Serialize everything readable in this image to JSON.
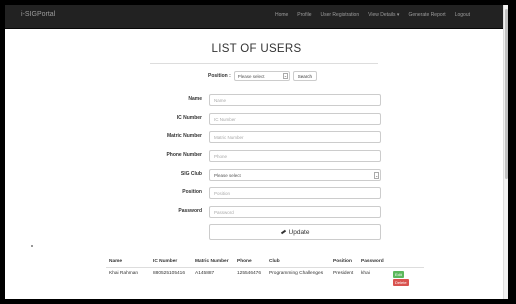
{
  "navbar": {
    "brand": "i-SIGPortal",
    "links": [
      "Home",
      "Profile",
      "User Registration",
      "View Details ▾",
      "Generate Report",
      "Logout"
    ]
  },
  "page_title": "LIST OF USERS",
  "filter": {
    "label": "Position :",
    "select_value": "Please select",
    "search_button": "Search"
  },
  "form": {
    "name": {
      "label": "Name",
      "placeholder": "Name"
    },
    "ic_number": {
      "label": "IC Number",
      "placeholder": "IC Number"
    },
    "matric_number": {
      "label": "Matric Number",
      "placeholder": "Matric Number"
    },
    "phone_number": {
      "label": "Phone Number",
      "placeholder": "Phone"
    },
    "sig_club": {
      "label": "SIG Club",
      "value": "Please select"
    },
    "position": {
      "label": "Position",
      "placeholder": "Position"
    },
    "password": {
      "label": "Password",
      "placeholder": "Password"
    },
    "update_button": "Update"
  },
  "table": {
    "headers": [
      "Name",
      "IC Number",
      "Matric Number",
      "Phone",
      "Club",
      "Position",
      "Password",
      ""
    ],
    "rows": [
      {
        "name": "Khai Rahman",
        "ic": "880525105416",
        "matric": "A145887",
        "phone": "125546476",
        "club": "Programming Challenges",
        "position": "President",
        "password": "khai",
        "edit_label": "Edit",
        "delete_label": "Delete"
      }
    ]
  }
}
